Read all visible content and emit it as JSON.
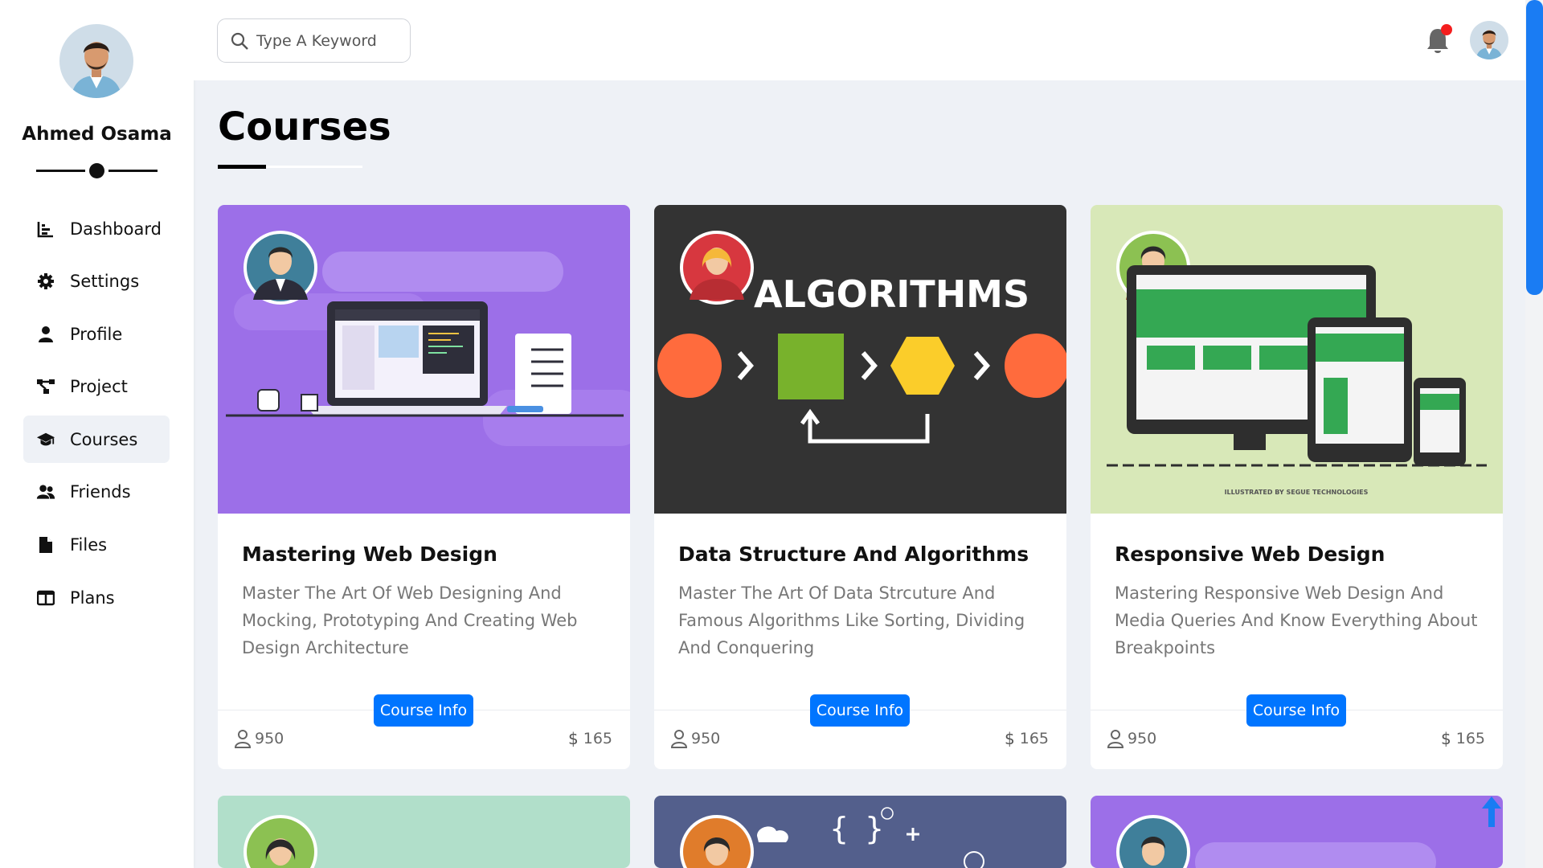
{
  "user": {
    "name": "Ahmed Osama"
  },
  "sidebar": {
    "items": [
      {
        "label": "Dashboard",
        "icon": "chart-icon"
      },
      {
        "label": "Settings",
        "icon": "gear-icon"
      },
      {
        "label": "Profile",
        "icon": "user-icon"
      },
      {
        "label": "Project",
        "icon": "diagram-icon"
      },
      {
        "label": "Courses",
        "icon": "graduation-cap-icon",
        "active": true
      },
      {
        "label": "Friends",
        "icon": "users-icon"
      },
      {
        "label": "Files",
        "icon": "file-icon"
      },
      {
        "label": "Plans",
        "icon": "columns-icon"
      }
    ]
  },
  "header": {
    "search_placeholder": "Type A Keyword",
    "notification_badge_color": "#f41e1e"
  },
  "page": {
    "title": "Courses"
  },
  "courses": [
    {
      "title": "Mastering Web Design",
      "description": "Master The Art Of Web Designing And Mocking, Prototyping And Creating Web Design Architecture",
      "button": "Course Info",
      "students": "950",
      "price": "165",
      "cover_color": "#9c6fe8"
    },
    {
      "title": "Data Structure And Algorithms",
      "description": "Master The Art Of Data Strcuture And Famous Algorithms Like Sorting, Dividing And Conquering",
      "button": "Course Info",
      "students": "950",
      "price": "165",
      "cover_color": "#333333",
      "cover_text": "ALGORITHMS"
    },
    {
      "title": "Responsive Web Design",
      "description": "Mastering Responsive Web Design And Media Queries And Know Everything About Breakpoints",
      "button": "Course Info",
      "students": "950",
      "price": "165",
      "cover_color": "#d8e8b8",
      "cover_credit": "ILLUSTRATED BY SEGUE TECHNOLOGIES"
    }
  ],
  "colors": {
    "accent": "#0075ff",
    "background": "#eef1f6",
    "scrollbar": "#1a7cf3"
  }
}
